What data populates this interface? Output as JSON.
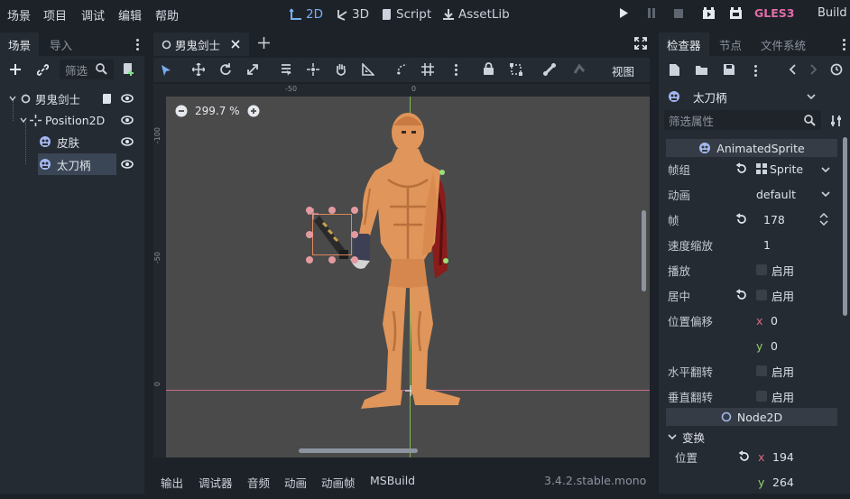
{
  "menu": [
    "场景",
    "项目",
    "调试",
    "编辑",
    "帮助"
  ],
  "workspaces": {
    "two_d": "2D",
    "three_d": "3D",
    "script": "Script",
    "assetlib": "AssetLib"
  },
  "renderer": "GLES3",
  "build": "Build",
  "scene_dock": {
    "tabs": [
      "场景",
      "导入"
    ],
    "filter_placeholder": "筛选",
    "nodes": [
      {
        "name": "男鬼剑士"
      },
      {
        "name": "Position2D"
      },
      {
        "name": "皮肤"
      },
      {
        "name": "太刀柄"
      }
    ]
  },
  "editor": {
    "tab_title": "男鬼剑士",
    "view_menu": "视图",
    "zoom": "299.7 %",
    "ruler_top": [
      "-50",
      "0"
    ],
    "ruler_left": [
      "-100",
      "-50",
      "0"
    ]
  },
  "bottom_panel": {
    "tabs": [
      "输出",
      "调试器",
      "音频",
      "动画",
      "动画帧",
      "MSBuild"
    ],
    "version": "3.4.2.stable.mono"
  },
  "inspector": {
    "tabs": [
      "检查器",
      "节点",
      "文件系统"
    ],
    "node_name": "太刀柄",
    "filter_placeholder": "筛选属性",
    "section_animatedsprite": "AnimatedSprite",
    "props": {
      "frames_label": "帧组",
      "frames_value": "Sprite",
      "animation_label": "动画",
      "animation_value": "default",
      "frame_label": "帧",
      "frame_value": "178",
      "speed_label": "速度缩放",
      "speed_value": "1",
      "playing_label": "播放",
      "playing_value": "启用",
      "centered_label": "居中",
      "centered_value": "启用",
      "offset_label": "位置偏移",
      "offset_x": "0",
      "offset_y": "0",
      "flip_h_label": "水平翻转",
      "flip_h_value": "启用",
      "flip_v_label": "垂直翻转",
      "flip_v_value": "启用"
    },
    "section_node2d": "Node2D",
    "transform_label": "变换",
    "position_label": "位置",
    "position_x": "194",
    "position_y": "264",
    "axis_x": "x",
    "axis_y": "y"
  },
  "colors": {
    "accent_blue": "#78aef0",
    "gles_pink": "#e26ca8",
    "selection_orange": "#e0875a",
    "skin": "#e0955a"
  }
}
